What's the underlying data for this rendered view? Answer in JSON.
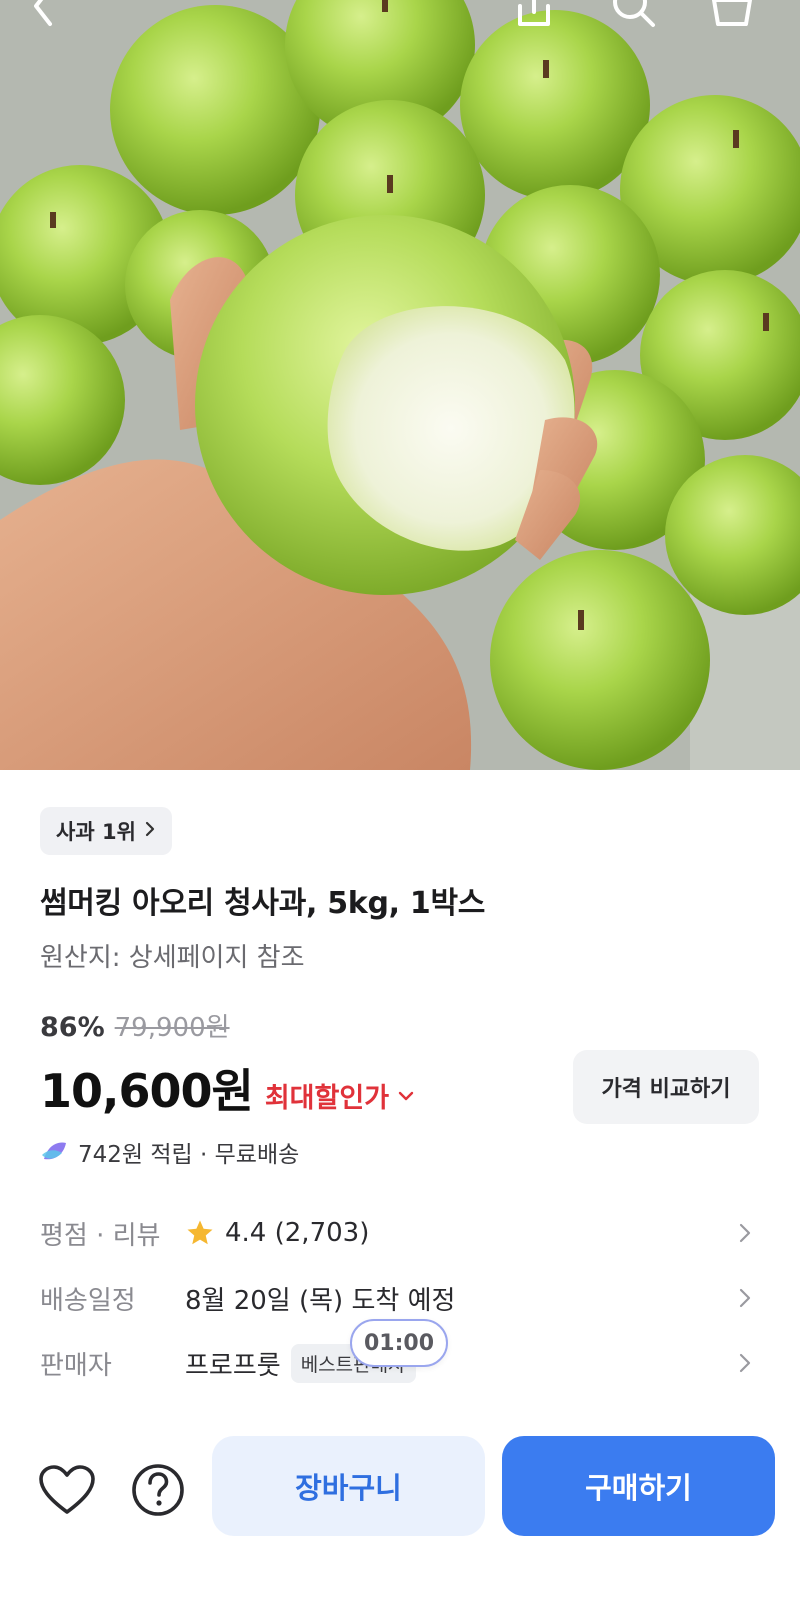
{
  "header": {
    "back_icon": "chevron-left-icon",
    "share_icon": "share-icon",
    "search_icon": "search-icon",
    "cart_icon": "shopping-basket-icon"
  },
  "product": {
    "rank_badge": "사과 1위",
    "title": "썸머킹 아오리 청사과, 5kg, 1박스",
    "origin": "원산지: 상세페이지 참조"
  },
  "pricing": {
    "discount_rate": "86%",
    "original_price": "79,900원",
    "sale_price": "10,600원",
    "max_discount_label": "최대할인가",
    "compare_button": "가격 비교하기",
    "benefit": "742원 적립 · 무료배송"
  },
  "info": {
    "rating_label": "평점 · 리뷰",
    "rating_value": "4.4 (2,703)",
    "delivery_label": "배송일정",
    "delivery_value": "8월 20일 (목) 도착 예정",
    "seller_label": "판매자",
    "seller_value": "프로프룻",
    "seller_badge": "베스트판매자",
    "timer": "01:00"
  },
  "actions": {
    "cart_label": "장바구니",
    "buy_label": "구매하기",
    "wishlist_icon": "heart-icon",
    "inquiry_icon": "question-icon"
  },
  "colors": {
    "accent": "#3b7cf0",
    "accent_light": "#eaf1fd",
    "discount_red": "#e0323a",
    "star": "#f5b731"
  }
}
